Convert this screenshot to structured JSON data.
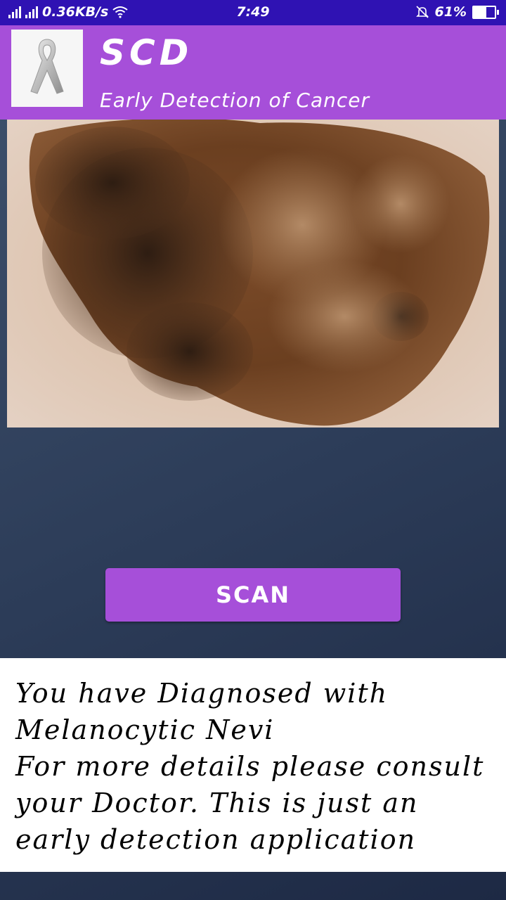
{
  "status_bar": {
    "network_speed": "0.36KB/s",
    "time": "7:49",
    "battery_percent": "61%",
    "battery_level": 0.61,
    "icons": [
      "signal-icon",
      "signal-icon",
      "wifi-icon",
      "mute-bell-icon",
      "battery-icon"
    ]
  },
  "app_bar": {
    "title": "SCD",
    "subtitle": "Early Detection of Cancer",
    "logo_icon": "awareness-ribbon-icon",
    "color": "#a64fd9"
  },
  "photo": {
    "description_icon": "skin-lesion-image"
  },
  "scan_button": {
    "label": "SCAN"
  },
  "result": {
    "text": "You have Diagnosed with\nMelanocytic Nevi\nFor more details please consult your Doctor. This is just an early detection application"
  },
  "colors": {
    "status_bar": "#2f12b3",
    "accent": "#a64fd9"
  }
}
